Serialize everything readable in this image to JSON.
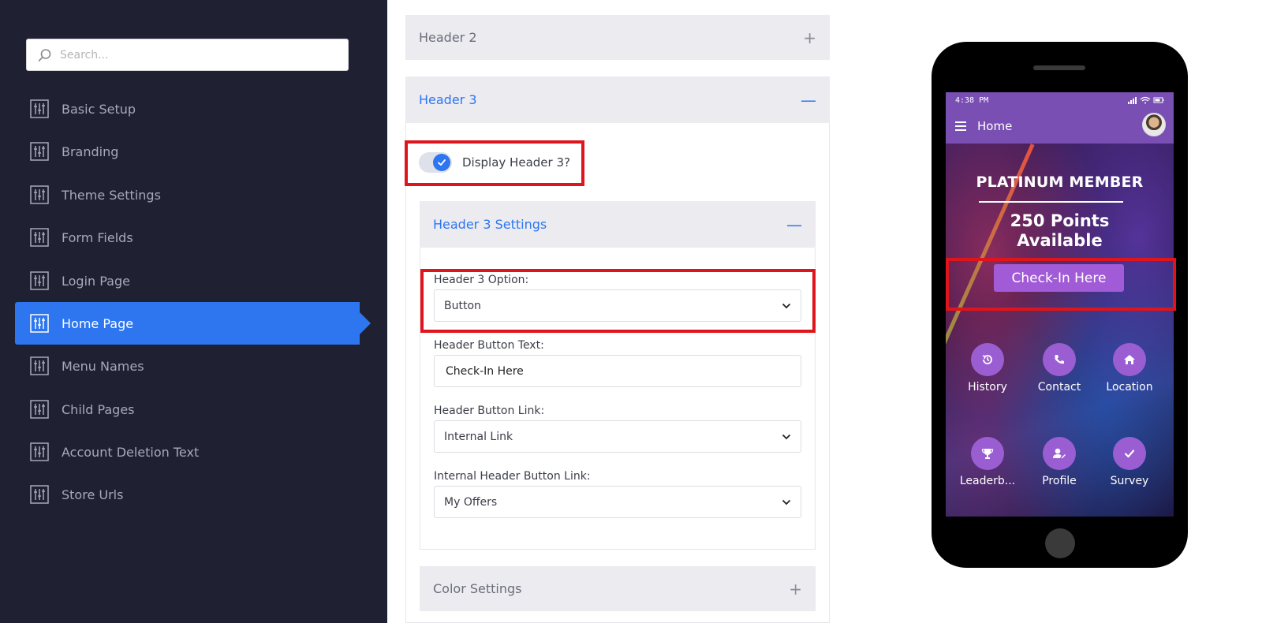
{
  "sidebar": {
    "search_placeholder": "Search...",
    "items": [
      {
        "label": "Basic Setup"
      },
      {
        "label": "Branding"
      },
      {
        "label": "Theme Settings"
      },
      {
        "label": "Form Fields"
      },
      {
        "label": "Login Page"
      },
      {
        "label": "Home Page",
        "active": true
      },
      {
        "label": "Menu Names"
      },
      {
        "label": "Child Pages"
      },
      {
        "label": "Account Deletion Text"
      },
      {
        "label": "Store Urls"
      }
    ]
  },
  "panel": {
    "header2": {
      "title": "Header 2",
      "sign": "+"
    },
    "header3": {
      "title": "Header 3",
      "sign": "—"
    },
    "display_toggle": {
      "label": "Display Header 3?",
      "checked": true
    },
    "settings": {
      "title": "Header 3 Settings",
      "sign": "—"
    },
    "option": {
      "label": "Header 3 Option:",
      "value": "Button"
    },
    "button_text": {
      "label": "Header Button Text:",
      "value": "Check-In Here"
    },
    "button_link": {
      "label": "Header Button Link:",
      "value": "Internal Link"
    },
    "internal_link": {
      "label": "Internal Header Button Link:",
      "value": "My Offers"
    },
    "color_settings": {
      "title": "Color Settings",
      "sign": "+"
    }
  },
  "preview": {
    "time": "4:38 PM",
    "app_title": "Home",
    "member_title": "PLATINUM MEMBER",
    "points_line1": "250 Points",
    "points_line2": "Available",
    "cta_label": "Check-In Here",
    "quick_actions": [
      {
        "label": "History",
        "icon": "history-icon"
      },
      {
        "label": "Contact",
        "icon": "phone-icon"
      },
      {
        "label": "Location",
        "icon": "home-icon"
      },
      {
        "label": "Leaderb...",
        "icon": "trophy-icon"
      },
      {
        "label": "Profile",
        "icon": "profile-edit-icon"
      },
      {
        "label": "Survey",
        "icon": "check-icon"
      }
    ]
  },
  "colors": {
    "sidebar_bg": "#1f2032",
    "accent": "#2d76f0",
    "highlight": "#e0141b",
    "app_purple": "#7a4fb4"
  }
}
